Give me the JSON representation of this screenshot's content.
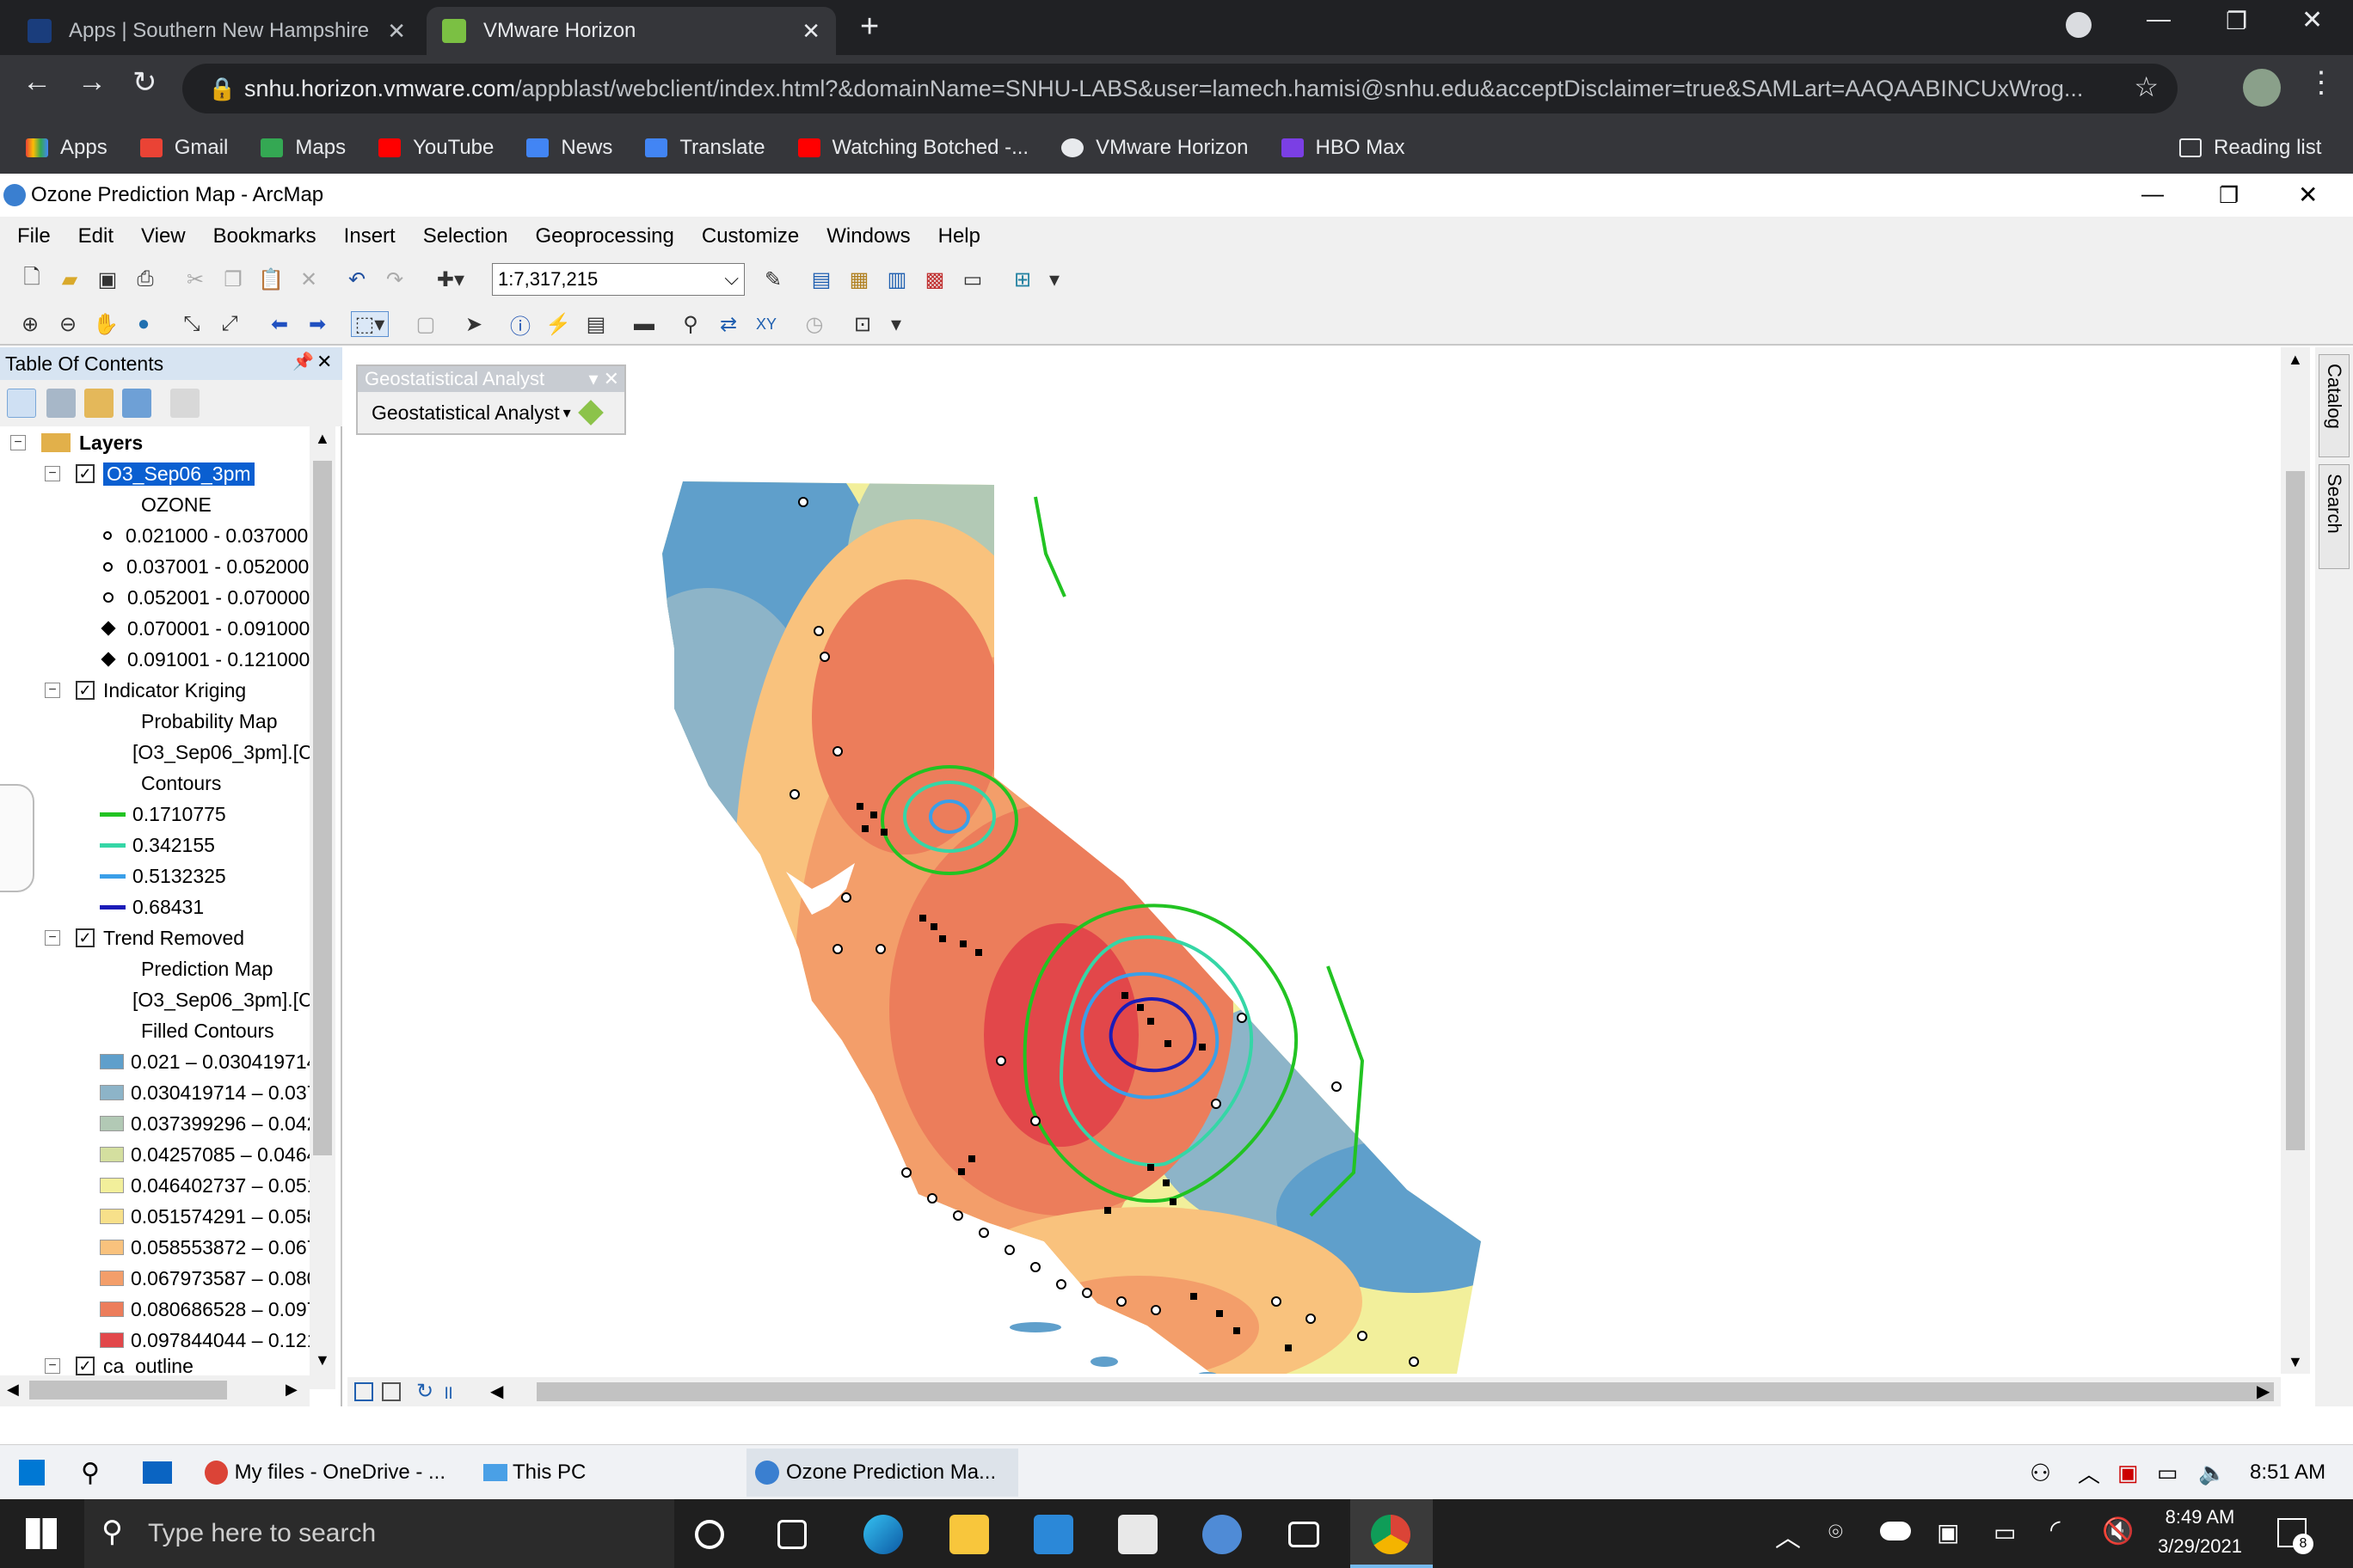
{
  "browser": {
    "tabs": [
      {
        "label": "Apps | Southern New Hampshire",
        "active": false
      },
      {
        "label": "VMware Horizon",
        "active": true
      }
    ],
    "url_host": "snhu.horizon.vmware.com",
    "url_path": "/appblast/webclient/index.html?&domainName=SNHU-LABS&user=lamech.hamisi@snhu.edu&acceptDisclaimer=true&SAMLart=AAQAABINCUxWrog...",
    "bookmarks": [
      "Apps",
      "Gmail",
      "Maps",
      "YouTube",
      "News",
      "Translate",
      "Watching Botched -...",
      "VMware Horizon",
      "HBO Max"
    ],
    "reading_list": "Reading list"
  },
  "arcmap": {
    "title": "Ozone Prediction Map - ArcMap",
    "menus": [
      "File",
      "Edit",
      "View",
      "Bookmarks",
      "Insert",
      "Selection",
      "Geoprocessing",
      "Customize",
      "Windows",
      "Help"
    ],
    "scale": "1:7,317,215",
    "toc_title": "Table Of Contents",
    "geo_toolbar_title": "Geostatistical Analyst",
    "geo_toolbar_button": "Geostatistical Analyst",
    "dock_tabs": [
      "Catalog",
      "Search"
    ],
    "layers_root": "Layers",
    "toc": {
      "o3": {
        "name": "O3_Sep06_3pm",
        "field": "OZONE",
        "classes": [
          "0.021000 - 0.037000",
          "0.037001 - 0.052000",
          "0.052001 - 0.070000",
          "0.070001 - 0.091000",
          "0.091001 - 0.121000"
        ]
      },
      "ik": {
        "name": "Indicator Kriging",
        "sub1": "Probability Map",
        "sub2": "[O3_Sep06_3pm].[C",
        "sub3": "Contours",
        "contours": [
          {
            "label": "0.1710775",
            "color": "#22c322"
          },
          {
            "label": "0.342155",
            "color": "#35d6a6"
          },
          {
            "label": "0.5132325",
            "color": "#3a9fe8"
          },
          {
            "label": "0.68431",
            "color": "#1b1bb8"
          }
        ]
      },
      "tr": {
        "name": "Trend Removed",
        "sub1": "Prediction Map",
        "sub2": "[O3_Sep06_3pm].[C",
        "sub3": "Filled Contours",
        "classes": [
          {
            "label": "0.021 – 0.030419714",
            "color": "#5f9fcb"
          },
          {
            "label": "0.030419714 – 0.037",
            "color": "#8db4c8"
          },
          {
            "label": "0.037399296 – 0.042",
            "color": "#b2c9b5"
          },
          {
            "label": "0.04257085 – 0.0464",
            "color": "#d4df9f"
          },
          {
            "label": "0.046402737 – 0.051",
            "color": "#f2ef9b"
          },
          {
            "label": "0.051574291 – 0.058",
            "color": "#f7e08a"
          },
          {
            "label": "0.058553872 – 0.067",
            "color": "#f9c27d"
          },
          {
            "label": "0.067973587 – 0.080",
            "color": "#f39e6a"
          },
          {
            "label": "0.080686528 – 0.097",
            "color": "#ec7d5b"
          },
          {
            "label": "0.097844044 – 0.121",
            "color": "#e2474a"
          }
        ]
      },
      "ca": {
        "name": "ca_outline"
      }
    }
  },
  "vdi_taskbar": {
    "items": [
      "My files - OneDrive - ...",
      "This PC",
      "Ozone Prediction Ma..."
    ],
    "time": "8:51 AM"
  },
  "windows_taskbar": {
    "search_placeholder": "Type here to search",
    "time": "8:49 AM",
    "date": "3/29/2021",
    "notifications": "8"
  }
}
